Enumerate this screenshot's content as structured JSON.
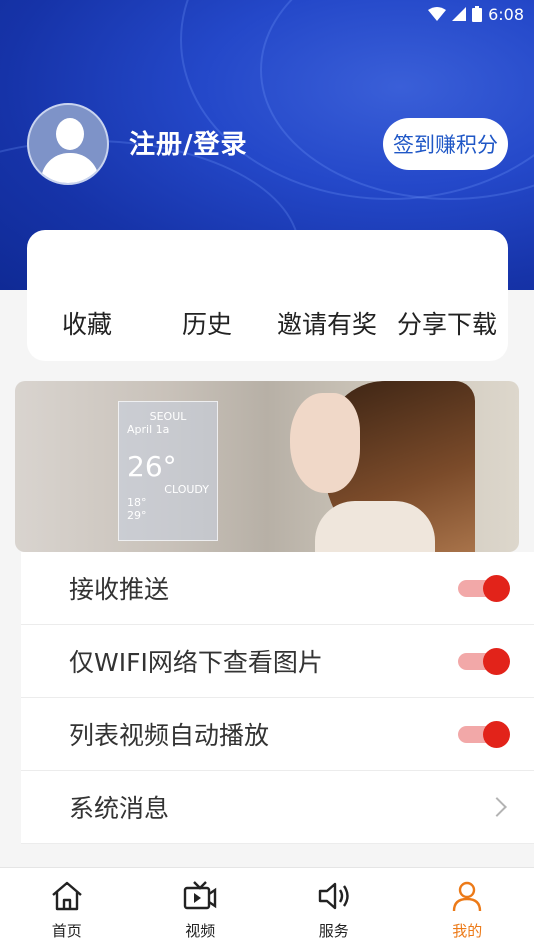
{
  "status_bar": {
    "time": "6:08"
  },
  "profile": {
    "login_label": "注册/登录",
    "checkin_button": "签到赚积分"
  },
  "quick_actions": [
    "收藏",
    "历史",
    "邀请有奖",
    "分享下载"
  ],
  "banner": {
    "city": "SEOUL",
    "date": "April 1a",
    "temperature": "26°",
    "condition": "CLOUDY",
    "low": "18°",
    "high": "29°"
  },
  "settings": [
    {
      "label": "接收推送",
      "type": "toggle",
      "on": true
    },
    {
      "label": "仅WIFI网络下查看图片",
      "type": "toggle",
      "on": true
    },
    {
      "label": "列表视频自动播放",
      "type": "toggle",
      "on": true
    },
    {
      "label": "系统消息",
      "type": "link"
    }
  ],
  "tabs": [
    {
      "label": "首页",
      "icon": "home-icon"
    },
    {
      "label": "视频",
      "icon": "video-icon"
    },
    {
      "label": "服务",
      "icon": "speaker-icon"
    },
    {
      "label": "我的",
      "icon": "user-icon",
      "active": true
    }
  ],
  "colors": {
    "header_blue": "#2448c9",
    "toggle_on": "#e2231a",
    "active_tab": "#ec7a18",
    "checkin_text": "#1f57c6"
  }
}
